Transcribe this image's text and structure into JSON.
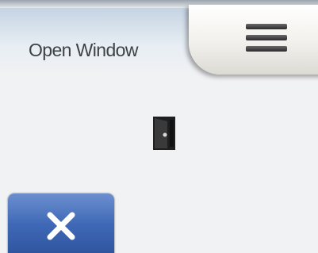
{
  "header": {
    "title": "Open Window",
    "menu_icon": "hamburger-menu-icon"
  },
  "status": {
    "icon": "open-door-icon"
  },
  "footer": {
    "close_icon": "close-icon"
  }
}
